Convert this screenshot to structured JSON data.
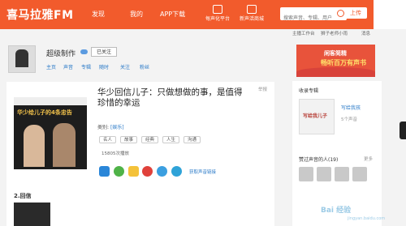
{
  "header": {
    "logo": "喜马拉雅FM",
    "nav": [
      "发现",
      "我的",
      "APP下载"
    ],
    "search_placeholder": "搜索声音、专辑、用户",
    "record_label": "每声化平台",
    "mall_label": "新声活商城",
    "upload_label": "上传",
    "accent_color": "#f25b2c"
  },
  "subbar": {
    "links": [
      "主播工作台",
      "狮子老师小雨",
      "消息"
    ]
  },
  "profile": {
    "name": "超级制作",
    "follow_label": "已关注",
    "tabs": [
      "主页",
      "声音",
      "专辑",
      "随时",
      "关注",
      "粉丝"
    ]
  },
  "track": {
    "report_label": "举报",
    "cover_title": "华少给儿子的4条忠告",
    "title": "华少回信儿子：只做想做的事，是值得珍惜的幸运",
    "category_label": "类别:",
    "category": "[娱乐]",
    "tags": [
      "名人",
      "故事",
      "经典",
      "人生",
      "沟通"
    ],
    "plays": "15805次播放",
    "share_link_label": "获取声音链接",
    "section2": "2.回信"
  },
  "sidebar": {
    "ad_line1": "闲客简精",
    "ad_line2": "畅听百万有声书",
    "album_header": "收录专辑",
    "album_thumb_text": "写给我儿子",
    "album_name": "写给我孩",
    "album_count": "5个声音",
    "likers_header": "赞过声音的人(19)",
    "more_label": "更多"
  },
  "watermark": {
    "text": "Bai 经验",
    "sub": "jingyan.baidu.com"
  }
}
